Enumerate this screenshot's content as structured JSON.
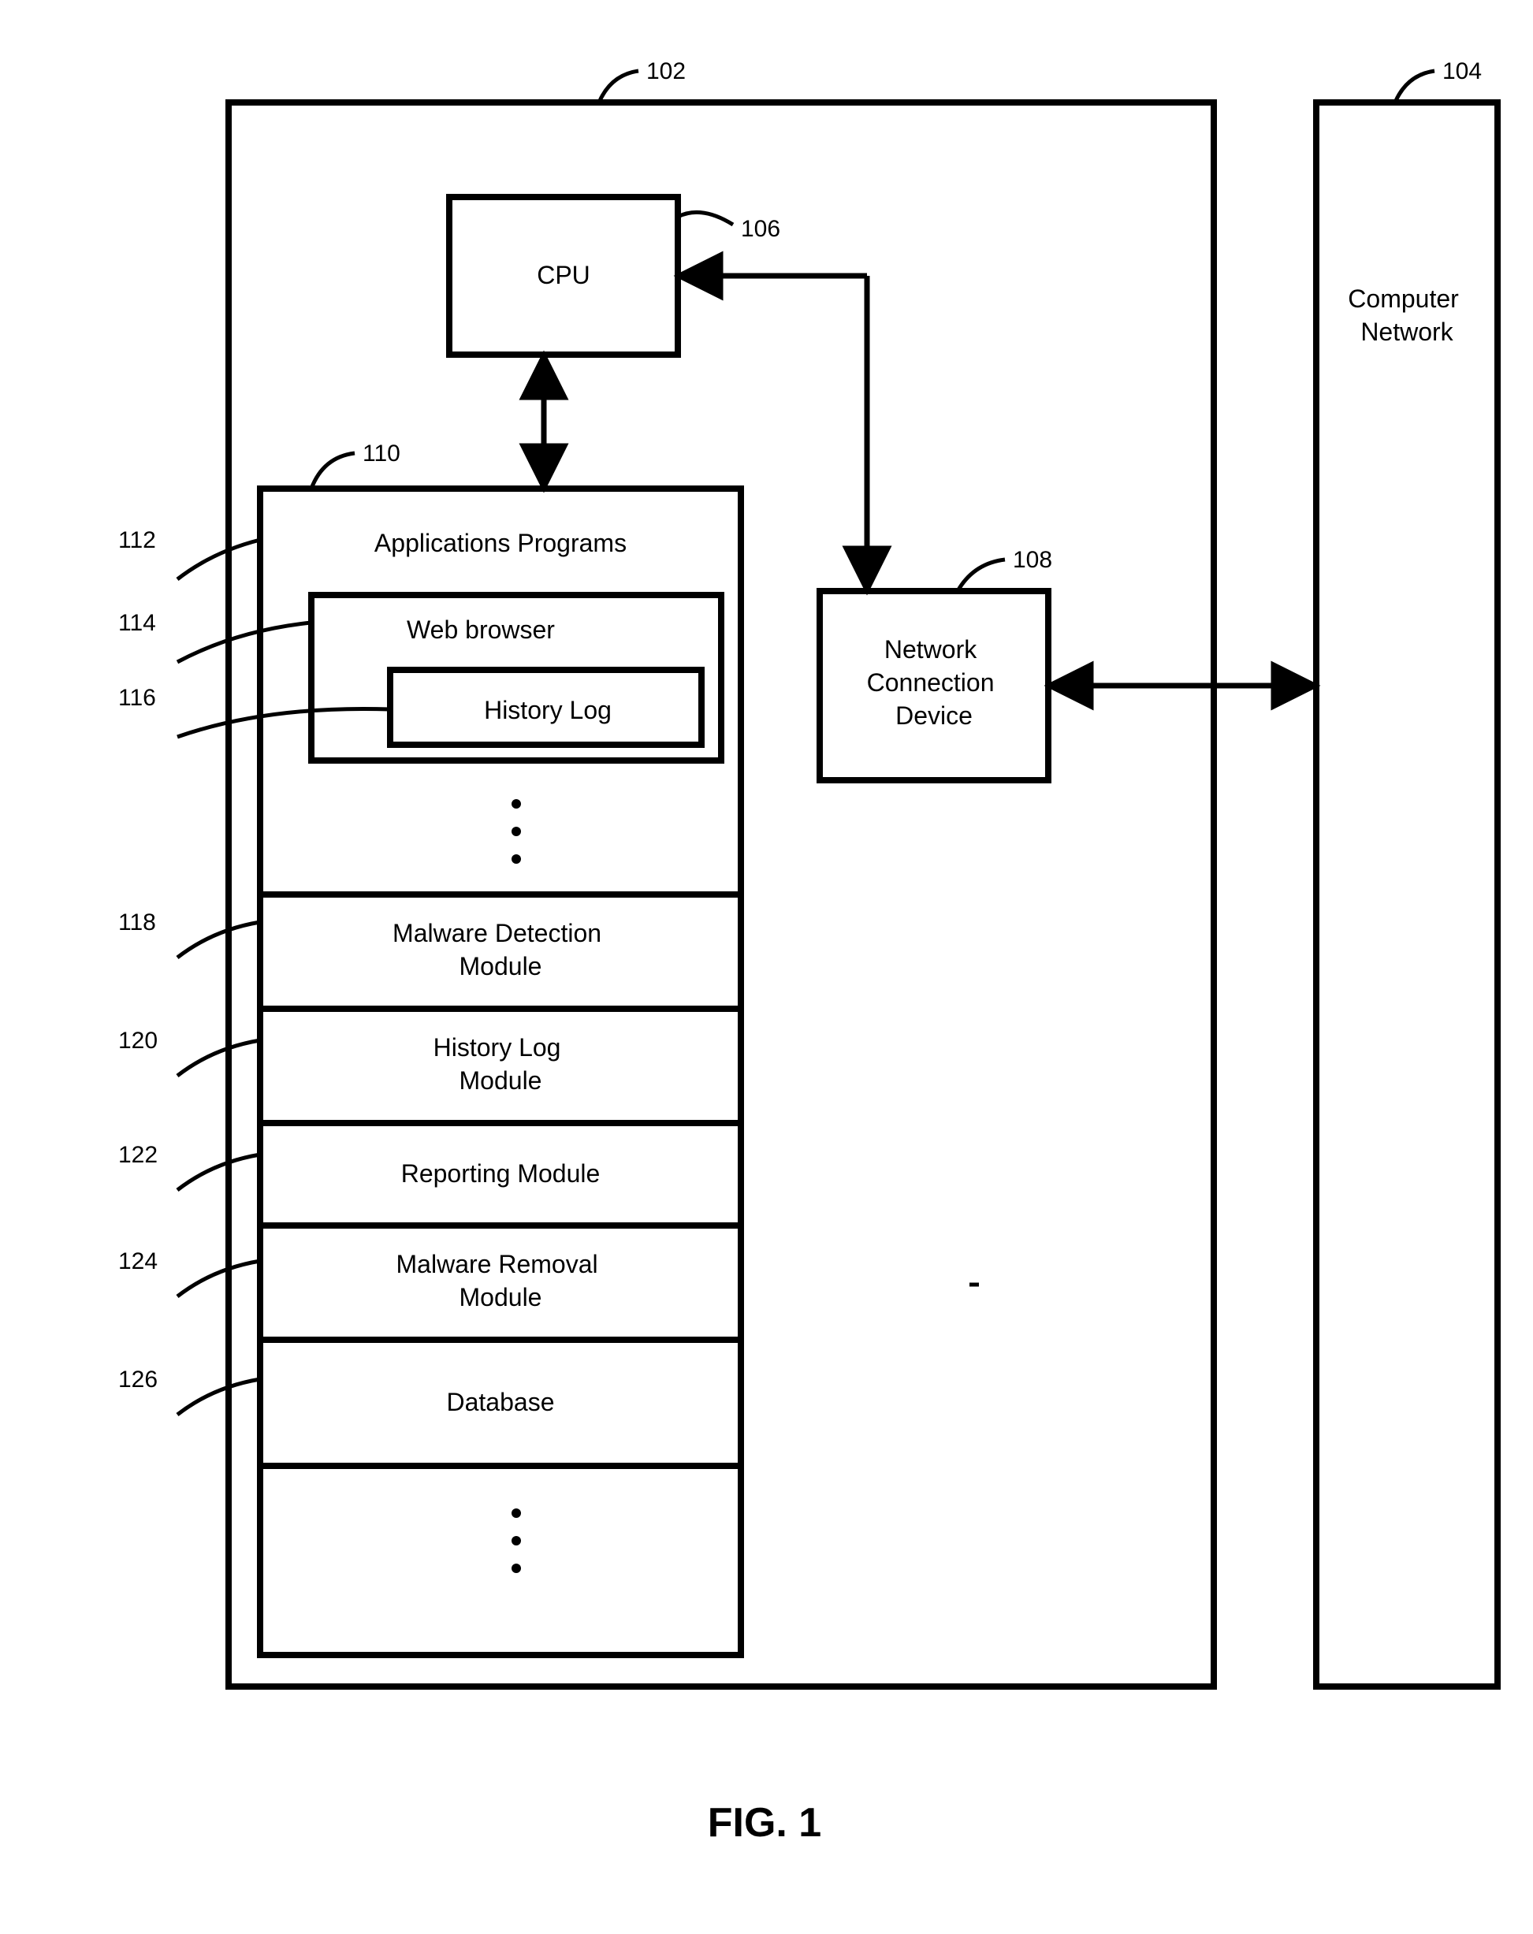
{
  "fig_label": "FIG. 1",
  "refs": {
    "r102": "102",
    "r104": "104",
    "r106": "106",
    "r108": "108",
    "r110": "110",
    "r112": "112",
    "r114": "114",
    "r116": "116",
    "r118": "118",
    "r120": "120",
    "r122": "122",
    "r124": "124",
    "r126": "126"
  },
  "blocks": {
    "cpu": "CPU",
    "net_dev_l1": "Network",
    "net_dev_l2": "Connection",
    "net_dev_l3": "Device",
    "comp_net_l1": "Computer",
    "comp_net_l2": "Network",
    "apps": "Applications Programs",
    "browser": "Web browser",
    "history_log": "History Log",
    "malware_det_l1": "Malware Detection",
    "malware_det_l2": "Module",
    "history_mod_l1": "History Log",
    "history_mod_l2": "Module",
    "reporting": "Reporting Module",
    "malware_rem_l1": "Malware Removal",
    "malware_rem_l2": "Module",
    "database": "Database"
  }
}
